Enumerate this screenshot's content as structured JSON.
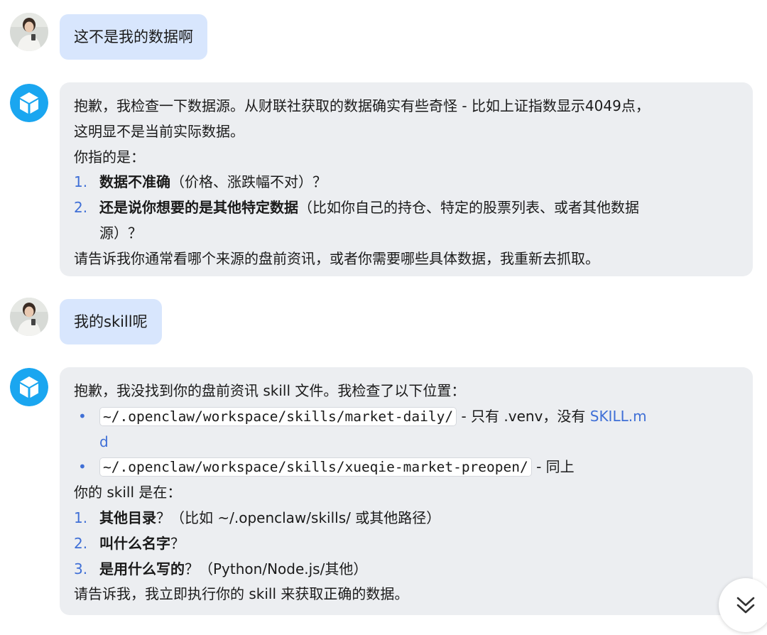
{
  "conversation": {
    "msg1": {
      "text": "这不是我的数据啊"
    },
    "msg2": {
      "line1": "抱歉，我检查一下数据源。从财联社获取的数据确实有些奇怪 - 比如上证指数显示4049点，",
      "line2": "这明显不是当前实际数据。",
      "line3": "你指的是：",
      "items": [
        {
          "num": "1.",
          "bold": "数据不准确",
          "rest": "（价格、涨跌幅不对）？"
        },
        {
          "num": "2.",
          "bold": "还是说你想要的是其他特定数据",
          "rest": "（比如你自己的持仓、特定的股票列表、或者其他数据",
          "cont": "源）？"
        }
      ],
      "closing": "请告诉我你通常看哪个来源的盘前资讯，或者你需要哪些具体数据，我重新去抓取。"
    },
    "msg3": {
      "text": "我的skill呢"
    },
    "msg4": {
      "intro": "抱歉，我没找到你的盘前资讯 skill 文件。我检查了以下位置：",
      "bullets": [
        {
          "code": "~/.openclaw/workspace/skills/market-daily/",
          "rest": " - 只有 .venv，没有 ",
          "link": "SKILL.m",
          "link_cont": "d"
        },
        {
          "code": "~/.openclaw/workspace/skills/xueqie-market-preopen/",
          "rest": " - 同上"
        }
      ],
      "question": "你的 skill 是在：",
      "items": [
        {
          "num": "1.",
          "bold": "其他目录",
          "rest": "？（比如 ~/.openclaw/skills/ 或其他路径）"
        },
        {
          "num": "2.",
          "bold": "叫什么名字",
          "rest": "？"
        },
        {
          "num": "3.",
          "bold": "是用什么写的",
          "rest": "？（Python/Node.js/其他）"
        }
      ],
      "closing": "请告诉我，我立即执行你的 skill 来获取正确的数据。"
    }
  },
  "icons": {
    "user_avatar": "user-avatar-photo",
    "bot_avatar": "cube-icon",
    "scroll": "double-chevron-down-icon"
  },
  "colors": {
    "user_bubble": "#d8e6fd",
    "bot_bubble": "#eceef1",
    "accent": "#3f6fd6",
    "bot_avatar_bg": "#1aa6f0"
  }
}
